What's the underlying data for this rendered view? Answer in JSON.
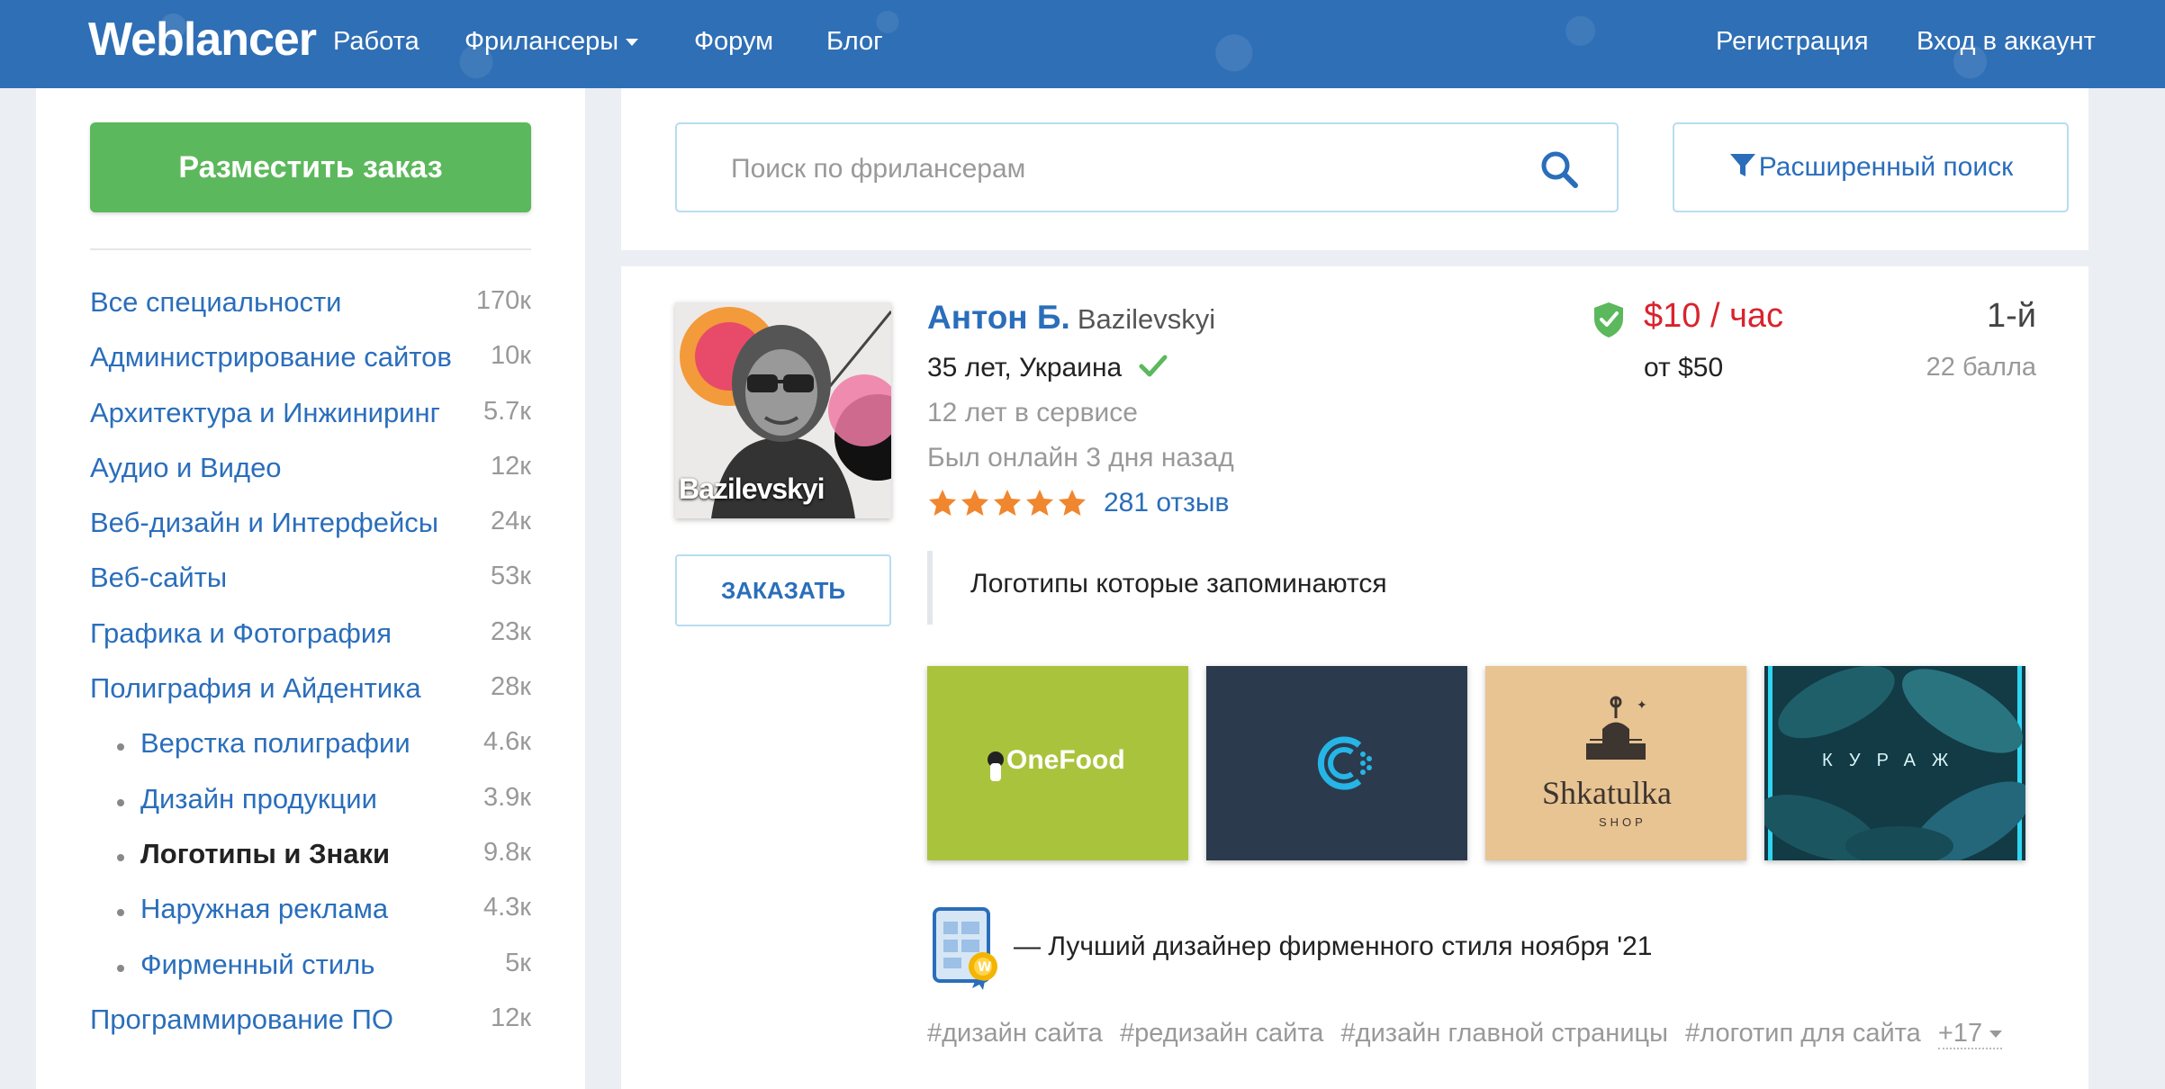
{
  "header": {
    "logo": "Weblancer",
    "nav": [
      {
        "label": "Работа"
      },
      {
        "label": "Фрилансеры",
        "has_dropdown": true
      },
      {
        "label": "Форум"
      },
      {
        "label": "Блог"
      }
    ],
    "register": "Регистрация",
    "login": "Вход в аккаунт"
  },
  "sidebar": {
    "post_order_button": "Разместить заказ",
    "categories": [
      {
        "name": "Все специальности",
        "count": "170к"
      },
      {
        "name": "Администрирование сайтов",
        "count": "10к"
      },
      {
        "name": "Архитектура и Инжиниринг",
        "count": "5.7к"
      },
      {
        "name": "Аудио и Видео",
        "count": "12к"
      },
      {
        "name": "Веб-дизайн и Интерфейсы",
        "count": "24к"
      },
      {
        "name": "Веб-сайты",
        "count": "53к"
      },
      {
        "name": "Графика и Фотография",
        "count": "23к"
      },
      {
        "name": "Полиграфия и Айдентика",
        "count": "28к"
      },
      {
        "name": "Верстка полиграфии",
        "count": "4.6к",
        "sub": true
      },
      {
        "name": "Дизайн продукции",
        "count": "3.9к",
        "sub": true
      },
      {
        "name": "Логотипы и Знаки",
        "count": "9.8к",
        "sub": true,
        "active": true
      },
      {
        "name": "Наружная реклама",
        "count": "4.3к",
        "sub": true
      },
      {
        "name": "Фирменный стиль",
        "count": "5к",
        "sub": true
      },
      {
        "name": "Программирование ПО",
        "count": "12к"
      }
    ]
  },
  "search": {
    "placeholder": "Поиск по фрилансерам",
    "advanced_button": "Расширенный поиск"
  },
  "freelancer": {
    "name": "Антон Б.",
    "login": "Bazilevskyi",
    "avatar_caption": "Bazilevskyi",
    "age_location": "35 лет, Украина",
    "in_service": "12 лет в сервисе",
    "last_online": "Был онлайн 3 дня назад",
    "rating_stars": 5,
    "reviews": "281 отзыв",
    "rate": "$10 / час",
    "rate_from": "от $50",
    "rank": "1-й",
    "points": "22 балла",
    "order_button": "ЗАКАЗАТЬ",
    "tagline": "Логотипы которые запоминаются",
    "portfolio": [
      {
        "label": "OneFood"
      },
      {
        "label": ""
      },
      {
        "label": "Shkatulka",
        "sublabel": "SHOP"
      },
      {
        "label": "КУРАЖ"
      }
    ],
    "award": "— Лучший дизайнер фирменного стиля ноября '21",
    "tags": [
      "#дизайн сайта",
      "#редизайн сайта",
      "#дизайн главной страницы",
      "#логотип для сайта"
    ],
    "more_tags": "+17"
  },
  "colors": {
    "header_bg": "#2f6fb5",
    "accent_green": "#5cb85c",
    "link_blue": "#2a6ebb",
    "price_red": "#d9232d",
    "star_orange": "#f0862e"
  }
}
